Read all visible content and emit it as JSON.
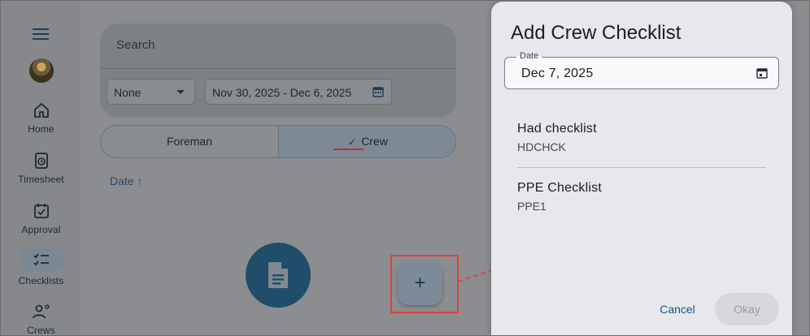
{
  "sidebar": {
    "items": [
      {
        "label": "Home",
        "icon": "home-icon"
      },
      {
        "label": "Timesheet",
        "icon": "timesheet-icon"
      },
      {
        "label": "Approval",
        "icon": "approval-icon"
      },
      {
        "label": "Checklists",
        "icon": "checklist-icon"
      },
      {
        "label": "Crews",
        "icon": "crews-icon"
      }
    ]
  },
  "filters": {
    "search_placeholder": "Search",
    "select_value": "None",
    "date_range": "Nov 30, 2025 - Dec 6, 2025"
  },
  "segment": {
    "left_label": "Foreman",
    "right_label": "Crew",
    "right_check": "✓"
  },
  "list": {
    "sort_label": "Date ↑"
  },
  "fab": {
    "label": "+"
  },
  "dialog": {
    "title": "Add Crew Checklist",
    "date_label": "Date",
    "date_value": "Dec 7, 2025",
    "items": [
      {
        "name": "Had checklist",
        "code": "HDCHCK"
      },
      {
        "name": "PPE Checklist",
        "code": "PPE1"
      }
    ],
    "cancel_label": "Cancel",
    "okay_label": "Okay"
  },
  "colors": {
    "accent": "#0c5a80",
    "highlight": "#e0403e",
    "dialog_bg": "#e8e8ec"
  }
}
